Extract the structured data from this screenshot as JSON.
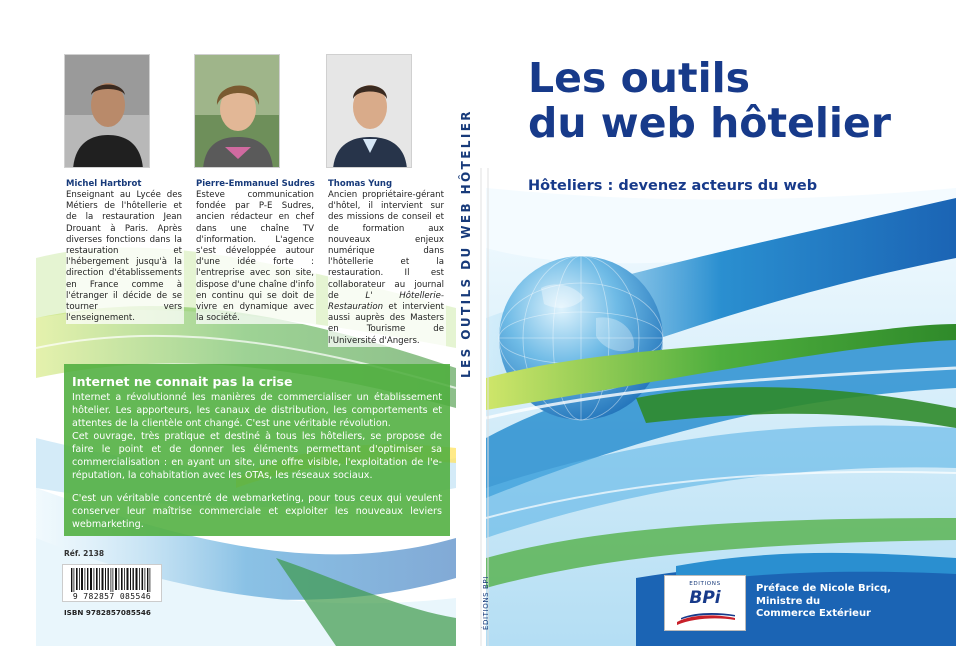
{
  "back_cover": {
    "authors": [
      {
        "name": "Michel Hartbrot",
        "bio": "Enseignant au Lycée des Métiers de l'hôtellerie et de la restauration Jean Drouant à Paris. Après diverses fonctions dans la restauration et l'hébergement jusqu'à la direction d'établissements en France comme à l'étranger il décide de se tourner vers l'enseignement."
      },
      {
        "name": "Pierre-Emmanuel Sudres",
        "bio": "Esteve communication fondée par P-E Sudres, ancien rédacteur en chef dans une chaîne TV d'information. L'agence s'est développée autour d'une idée forte : l'entreprise avec son site, dispose d'une chaîne d'info en continu qui se doit de vivre en dynamique avec la société."
      },
      {
        "name": "Thomas Yung",
        "bio_before": "Ancien propriétaire-gérant d'hôtel, il intervient sur des missions de conseil et de formation aux nouveaux enjeux numérique dans l'hôtellerie et la restauration. Il est collaborateur au journal de ",
        "bio_journal": "L' Hôtellerie-Restauration",
        "bio_after": " et intervient aussi auprès des Masters en Tourisme de l'Université d'Angers."
      }
    ],
    "blurb": {
      "heading": "Internet ne connait pas la crise",
      "paragraph_1": "Internet a révolutionné les manières de commercialiser un établissement hôtelier. Les apporteurs, les canaux de distribution, les comportements et attentes de la clientèle ont changé. C'est une véritable révolution.",
      "paragraph_2": "Cet ouvrage, très pratique et destiné à tous les hôteliers, se propose de faire le point et de donner les éléments permettant d'optimiser sa commercialisation : en ayant un site, une offre visible, l'exploitation de l'e-réputation, la cohabitation avec les OTAs, les réseaux sociaux.",
      "paragraph_3": "C'est un véritable concentré de webmarketing, pour tous ceux qui veulent conserver leur maîtrise commerciale et exploiter les nouveaux leviers webmarketing."
    },
    "ref": "Réf. 2138",
    "barcode_number": "9 782857 085546",
    "isbn": "ISBN 9782857085546"
  },
  "spine": {
    "title": "LES OUTILS DU WEB HÔTELIER",
    "publisher": "ÉDITIONS BPI"
  },
  "front_cover": {
    "title_line_1": "Les outils",
    "title_line_2": "du web hôtelier",
    "subtitle": "Hôteliers : devenez acteurs du web",
    "publisher_logo": {
      "small": "EDITIONS",
      "big": "BPi"
    },
    "preface": {
      "line_1": "Préface de Nicole Bricq,",
      "line_2": "Ministre du",
      "line_3": "Commerce Extérieur"
    }
  },
  "colors": {
    "title_blue": "#173a8a",
    "green": "#4eae3e",
    "swoosh_blue": "#2a8fd0",
    "light_blue": "#9fd4f0"
  }
}
